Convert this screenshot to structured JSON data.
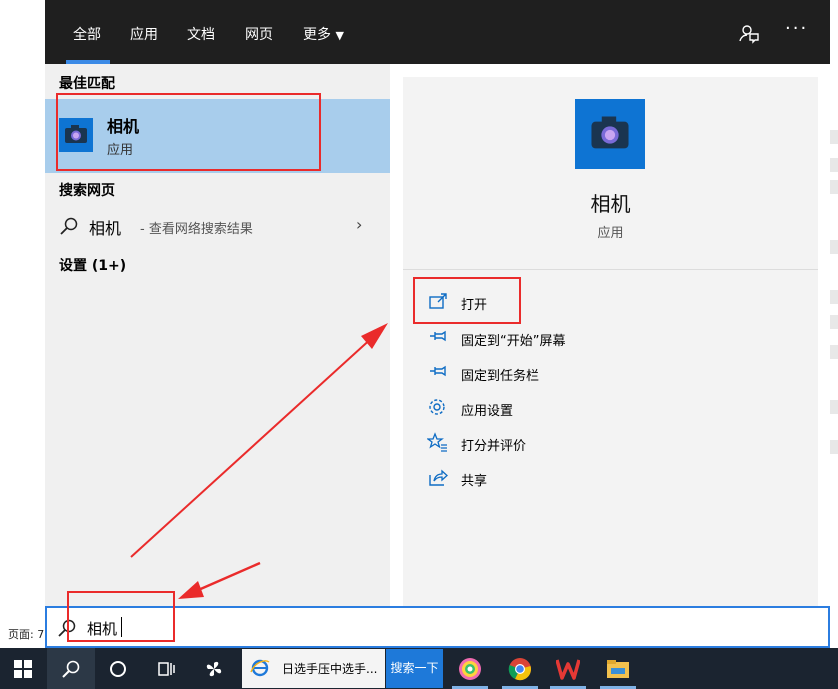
{
  "tabs": [
    "全部",
    "应用",
    "文档",
    "网页",
    "更多"
  ],
  "topbar_icons": {
    "feedback": "feedback-icon",
    "more": "···"
  },
  "left": {
    "best_match_title": "最佳匹配",
    "best_match": {
      "name": "相机",
      "type": "应用"
    },
    "web_title": "搜索网页",
    "web_result": {
      "query": "相机",
      "desc": " - 查看网络搜索结果"
    },
    "settings_title": "设置 (1+)"
  },
  "right": {
    "app_name": "相机",
    "app_type": "应用",
    "actions": [
      "打开",
      "固定到“开始”屏幕",
      "固定到任务栏",
      "应用设置",
      "打分并评价",
      "共享"
    ]
  },
  "search": {
    "value": "相机"
  },
  "background": {
    "page_label": "页面: 7"
  },
  "taskbar": {
    "ie_title": "日选手压中选手...",
    "ie_search_label": "搜索一下"
  },
  "colors": {
    "accent": "#0e74d3",
    "selection": "#a8cdec",
    "annotation": "#ea2b2b",
    "taskbar": "#1b2430"
  }
}
